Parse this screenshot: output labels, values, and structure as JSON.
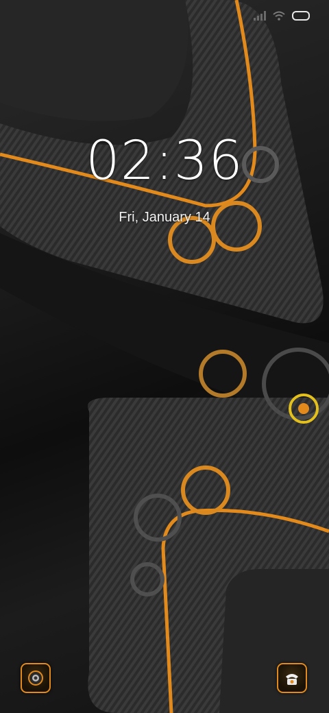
{
  "lockscreen": {
    "time": "02:36",
    "date": "Fri, January 14"
  },
  "status_bar": {
    "icons": [
      "signal-icon",
      "wifi-icon",
      "battery-icon"
    ]
  },
  "shortcuts": {
    "left": "camera-icon",
    "right": "phone-icon"
  },
  "colors": {
    "accent": "#e38a1c",
    "background": "#1a1a1a",
    "text": "#ffffff"
  }
}
